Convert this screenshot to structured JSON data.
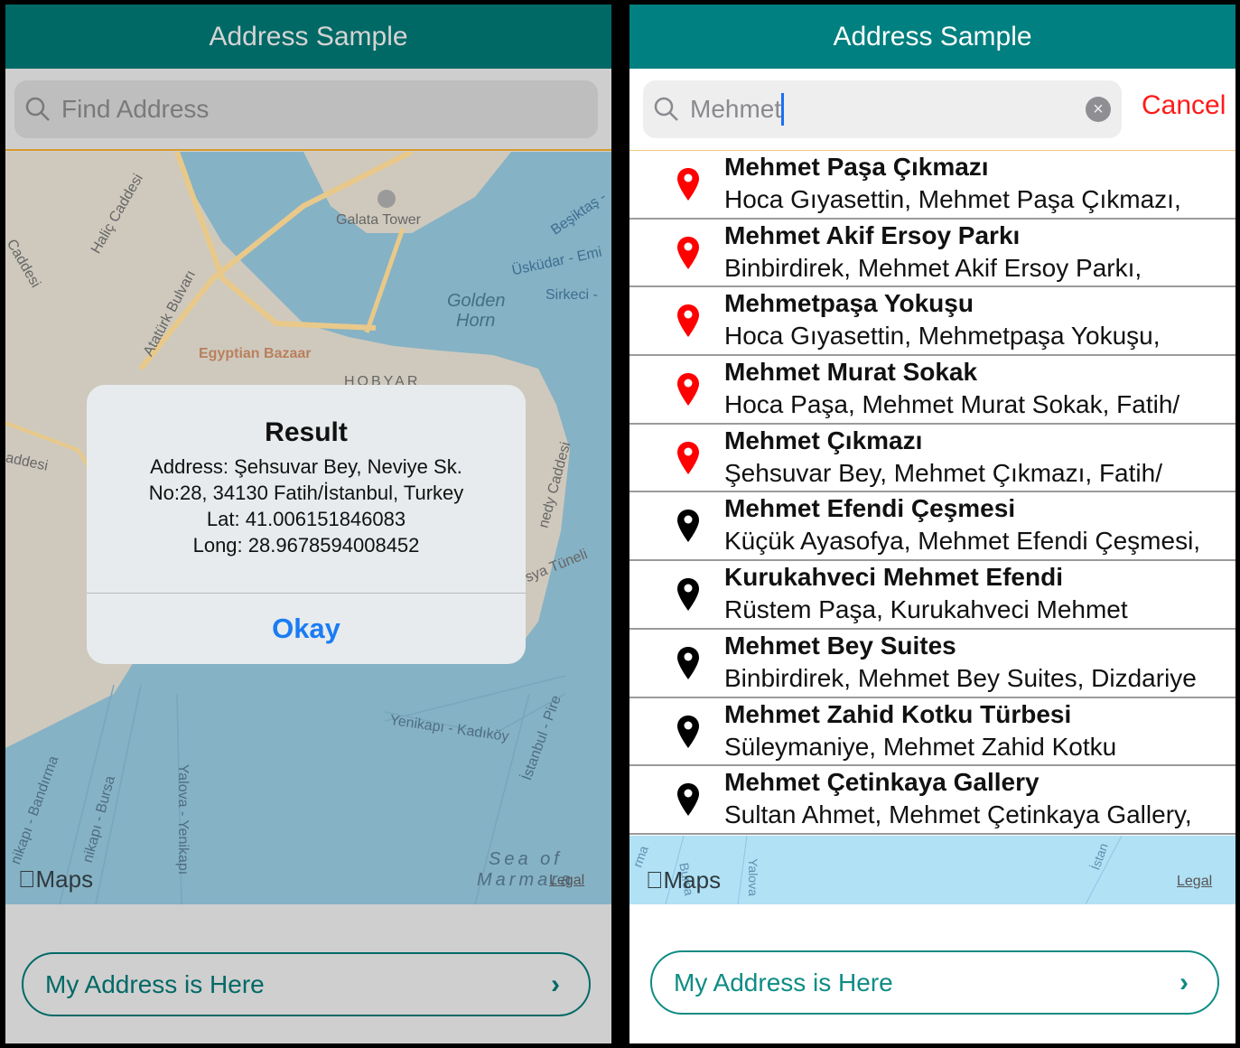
{
  "left": {
    "header": {
      "title": "Address Sample"
    },
    "search": {
      "placeholder": "Find Address"
    },
    "map": {
      "labels": [
        "Haliç Caddesi",
        "Caddesi",
        "Galata Tower",
        "Beşiktaş -",
        "Üsküdar - Emi",
        "Sirkeci -",
        "Golden",
        "Horn",
        "Atatürk Bulvarı",
        "Egyptian Bazaar",
        "HOBYAR",
        "addesi",
        "nedy Caddesi",
        "sya Tüneli",
        "Yenikapı - Kadıköy",
        "İstanbul - Pire",
        "nikapı - Bandırma",
        "nikapı - Bursa",
        "Yalova - Yenikapı",
        "Sea of",
        "Marmara"
      ],
      "maps_logo": "Maps",
      "legal": "Legal"
    },
    "dialog": {
      "title": "Result",
      "lines": [
        "Address: Şehsuvar Bey, Neviye Sk.",
        "No:28, 34130 Fatih/İstanbul, Turkey",
        "Lat: 41.006151846083",
        "Long: 28.9678594008452"
      ],
      "button": "Okay"
    },
    "bottom_button": {
      "label": "My Address is Here",
      "icon": "chevron-right-icon"
    }
  },
  "right": {
    "header": {
      "title": "Address Sample"
    },
    "search": {
      "value": "Mehmet",
      "cancel": "Cancel"
    },
    "results": [
      {
        "title": "Mehmet Paşa Çıkmazı",
        "subtitle": "Hoca Gıyasettin, Mehmet Paşa Çıkmazı,",
        "pin_color": "#ff0000"
      },
      {
        "title": "Mehmet Akif Ersoy Parkı",
        "subtitle": "Binbirdirek, Mehmet Akif Ersoy Parkı,",
        "pin_color": "#ff0000"
      },
      {
        "title": "Mehmetpaşa Yokuşu",
        "subtitle": "Hoca Gıyasettin, Mehmetpaşa Yokuşu,",
        "pin_color": "#ff0000"
      },
      {
        "title": "Mehmet Murat Sokak",
        "subtitle": "Hoca Paşa, Mehmet Murat Sokak, Fatih/",
        "pin_color": "#ff0000"
      },
      {
        "title": "Mehmet Çıkmazı",
        "subtitle": "Şehsuvar Bey, Mehmet Çıkmazı, Fatih/",
        "pin_color": "#ff0000"
      },
      {
        "title": "Mehmet Efendi Çeşmesi",
        "subtitle": "Küçük Ayasofya, Mehmet Efendi Çeşmesi,",
        "pin_color": "#000000"
      },
      {
        "title": "Kurukahveci Mehmet Efendi",
        "subtitle": "Rüstem Paşa, Kurukahveci Mehmet",
        "pin_color": "#000000"
      },
      {
        "title": "Mehmet Bey Suites",
        "subtitle": "Binbirdirek, Mehmet Bey Suites, Dizdariye",
        "pin_color": "#000000"
      },
      {
        "title": "Mehmet Zahid Kotku Türbesi",
        "subtitle": "Süleymaniye, Mehmet Zahid Kotku",
        "pin_color": "#000000"
      },
      {
        "title": "Mehmet Çetinkaya Gallery",
        "subtitle": "Sultan Ahmet, Mehmet Çetinkaya Gallery,",
        "pin_color": "#000000"
      }
    ],
    "map": {
      "labels": [
        "rma",
        "Bursa",
        "Yalova",
        "İstan"
      ],
      "maps_logo": "Maps",
      "legal": "Legal"
    },
    "bottom_button": {
      "label": "My Address is Here",
      "icon": "chevron-right-icon"
    }
  }
}
